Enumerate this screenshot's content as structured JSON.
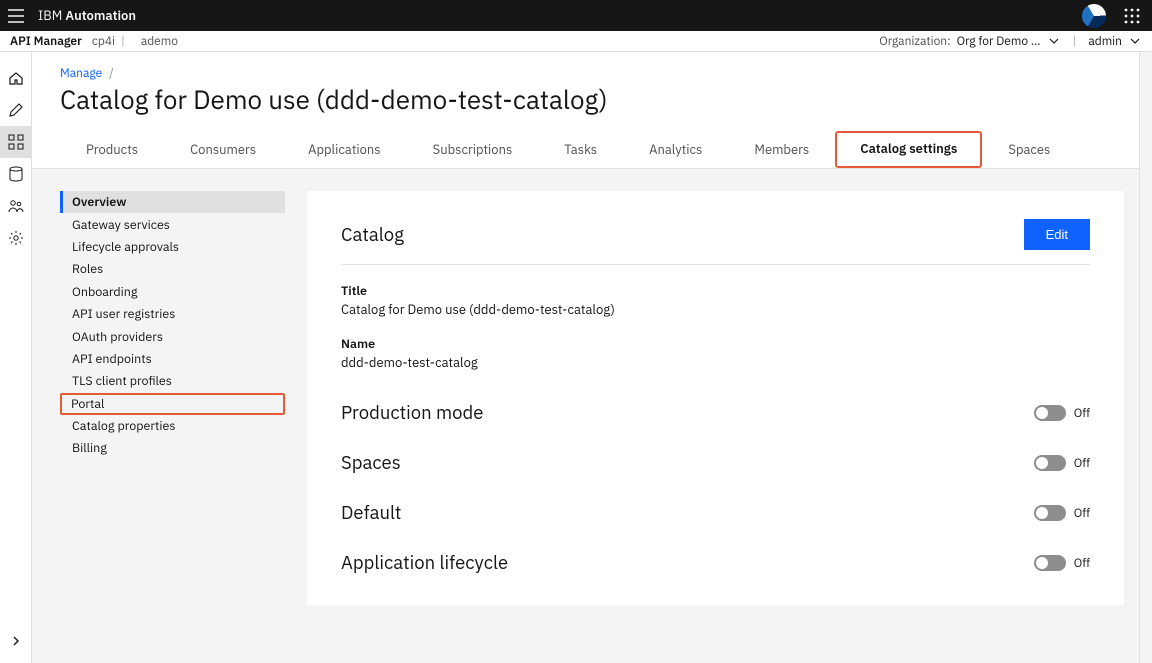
{
  "topbar": {
    "brand_prefix": "IBM",
    "brand_suffix": "Automation"
  },
  "subheader": {
    "app_title": "API Manager",
    "context1": "cp4i",
    "context2": "ademo",
    "org_label": "Organization:",
    "org_value": "Org for Demo …",
    "user": "admin"
  },
  "rail": [
    {
      "name": "home-icon"
    },
    {
      "name": "edit-icon"
    },
    {
      "name": "grid-icon"
    },
    {
      "name": "data-icon"
    },
    {
      "name": "members-icon"
    },
    {
      "name": "settings-icon"
    }
  ],
  "breadcrumb": {
    "manage": "Manage"
  },
  "page_title": "Catalog for Demo use (ddd-demo-test-catalog)",
  "tabs": [
    {
      "label": "Products"
    },
    {
      "label": "Consumers"
    },
    {
      "label": "Applications"
    },
    {
      "label": "Subscriptions"
    },
    {
      "label": "Tasks"
    },
    {
      "label": "Analytics"
    },
    {
      "label": "Members"
    },
    {
      "label": "Catalog settings",
      "active": true,
      "highlight": true
    },
    {
      "label": "Spaces"
    }
  ],
  "sidemenu": [
    {
      "label": "Overview",
      "active": true
    },
    {
      "label": "Gateway services"
    },
    {
      "label": "Lifecycle approvals"
    },
    {
      "label": "Roles"
    },
    {
      "label": "Onboarding"
    },
    {
      "label": "API user registries"
    },
    {
      "label": "OAuth providers"
    },
    {
      "label": "API endpoints"
    },
    {
      "label": "TLS client profiles"
    },
    {
      "label": "Portal",
      "highlight": true
    },
    {
      "label": "Catalog properties"
    },
    {
      "label": "Billing"
    }
  ],
  "card": {
    "heading": "Catalog",
    "edit": "Edit",
    "title_label": "Title",
    "title_value": "Catalog for Demo use (ddd-demo-test-catalog)",
    "name_label": "Name",
    "name_value": "ddd-demo-test-catalog",
    "toggles": [
      {
        "label": "Production mode",
        "state": "Off"
      },
      {
        "label": "Spaces",
        "state": "Off"
      },
      {
        "label": "Default",
        "state": "Off"
      },
      {
        "label": "Application lifecycle",
        "state": "Off"
      }
    ]
  }
}
